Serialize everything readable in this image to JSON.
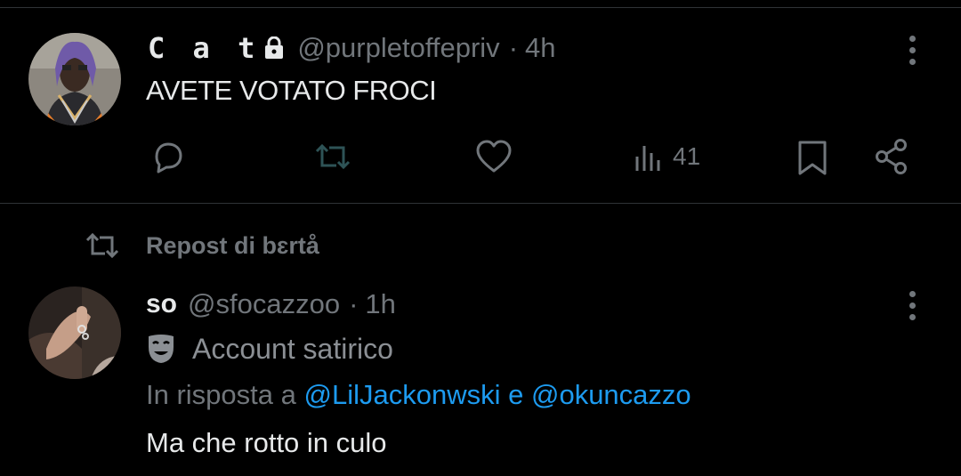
{
  "tweet1": {
    "display_name": "C a t",
    "handle": "@purpletoffepriv",
    "separator": "·",
    "time": "4h",
    "text": "AVETE VOTATO FROCI",
    "views": "41"
  },
  "repost": {
    "text": "Repost di bɛrtå"
  },
  "tweet2": {
    "display_name": "so",
    "handle": "@sfocazzoo",
    "separator": "·",
    "time": "1h",
    "label": "Account satirico",
    "reply_prefix": "In risposta a",
    "mention1": "@LilJackonwski",
    "conjunction": "e",
    "mention2": "@okuncazzo",
    "text": "Ma che rotto in culo"
  },
  "colors": {
    "background": "#000000",
    "text_primary": "#e7e9ea",
    "text_secondary": "#71767b",
    "link": "#1d9bf0",
    "divider": "#2f3336"
  },
  "icons": [
    "lock-icon",
    "more-icon",
    "reply-icon",
    "retweet-icon",
    "like-icon",
    "views-icon",
    "bookmark-icon",
    "share-icon",
    "repost-icon",
    "satire-mask-icon"
  ]
}
